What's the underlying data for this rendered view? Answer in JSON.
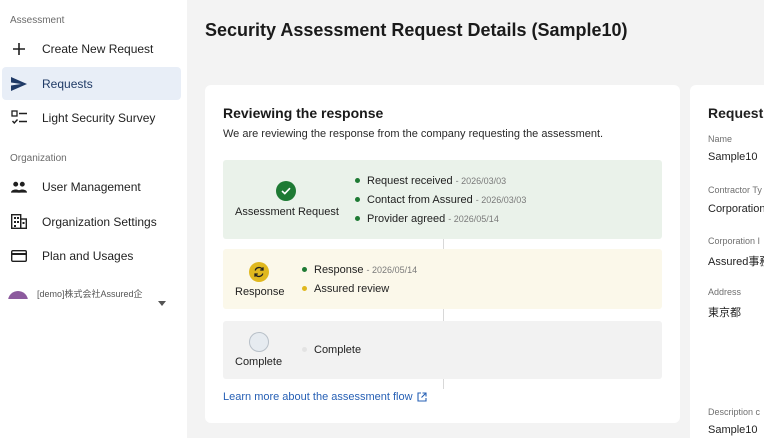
{
  "sidebar": {
    "section_assessment": "Assessment",
    "section_organization": "Organization",
    "items": [
      {
        "label": "Create New Request",
        "icon": "plus-icon"
      },
      {
        "label": "Requests",
        "icon": "send-icon",
        "active": true
      },
      {
        "label": "Light Security Survey",
        "icon": "checklist-icon"
      },
      {
        "label": "User Management",
        "icon": "users-icon"
      },
      {
        "label": "Organization Settings",
        "icon": "building-icon"
      },
      {
        "label": "Plan and Usages",
        "icon": "credit-card-icon"
      }
    ],
    "org_name": "[demo]株式会社Assured企"
  },
  "page": {
    "title": "Security Assessment Request Details (Sample10)"
  },
  "review": {
    "title": "Reviewing the response",
    "description": "We are reviewing the response from the company requesting the assessment.",
    "learn_more": "Learn more about the assessment flow",
    "stages": [
      {
        "label": "Assessment Request",
        "status": "done",
        "items": [
          {
            "text": "Request received",
            "date": "- 2026/03/03",
            "color": "#1e7a34"
          },
          {
            "text": "Contact from Assured",
            "date": "- 2026/03/03",
            "color": "#1e7a34"
          },
          {
            "text": "Provider agreed",
            "date": "- 2026/05/14",
            "color": "#1e7a34"
          }
        ]
      },
      {
        "label": "Response",
        "status": "in-progress",
        "items": [
          {
            "text": "Response",
            "date": "- 2026/05/14",
            "color": "#1e7a34"
          },
          {
            "text": "Assured review",
            "date": "",
            "color": "#e0b81e"
          }
        ]
      },
      {
        "label": "Complete",
        "status": "pending",
        "items": [
          {
            "text": "Complete",
            "date": "",
            "color": "#e3e3e3"
          }
        ]
      }
    ]
  },
  "request_panel": {
    "title": "Request I",
    "fields": [
      {
        "label": "Name",
        "value": "Sample10"
      },
      {
        "label": "Contractor Ty",
        "value": "Corporation"
      },
      {
        "label": "Corporation I",
        "value": "Assured事務"
      },
      {
        "label": "Address",
        "value": "東京都"
      },
      {
        "label": "Description c",
        "value": "Sample10"
      }
    ]
  },
  "colors": {
    "accent": "#1f3a66",
    "done_bg": "#eaf2ea",
    "in_progress_bg": "#fbf8ea",
    "pending_bg": "#f2f2f2",
    "link": "#2760b5"
  }
}
